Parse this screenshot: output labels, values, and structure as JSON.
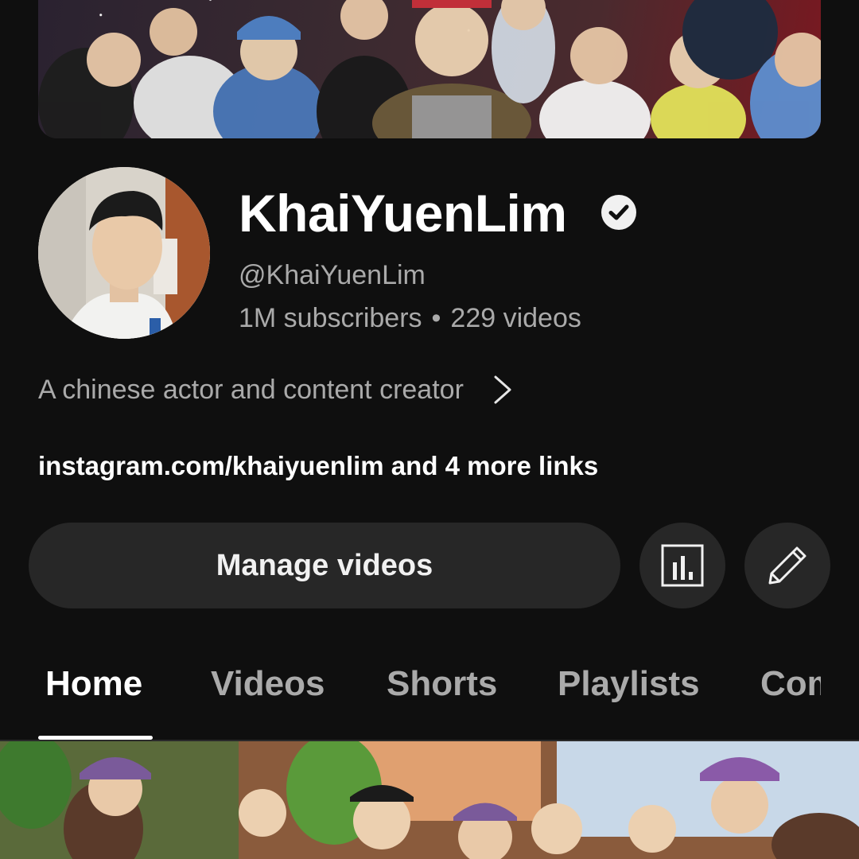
{
  "channel": {
    "name": "KhaiYuenLim",
    "handle": "@KhaiYuenLim",
    "subscribers": "1M subscribers",
    "separator": "•",
    "videos": "229 videos",
    "verified_icon": "verified-check-icon",
    "description": "A chinese actor and content creator",
    "links": "instagram.com/khaiyuenlim and 4 more links"
  },
  "actions": {
    "manage_videos_label": "Manage videos",
    "analytics_icon": "analytics-icon",
    "edit_icon": "pencil-icon"
  },
  "tabs": [
    {
      "label": "Home",
      "active": true
    },
    {
      "label": "Videos",
      "active": false
    },
    {
      "label": "Shorts",
      "active": false
    },
    {
      "label": "Playlists",
      "active": false
    },
    {
      "label": "Community",
      "active": false
    }
  ],
  "colors": {
    "background": "#0f0f0f",
    "button": "#272727",
    "text_primary": "#ffffff",
    "text_secondary": "#aaaaaa"
  }
}
